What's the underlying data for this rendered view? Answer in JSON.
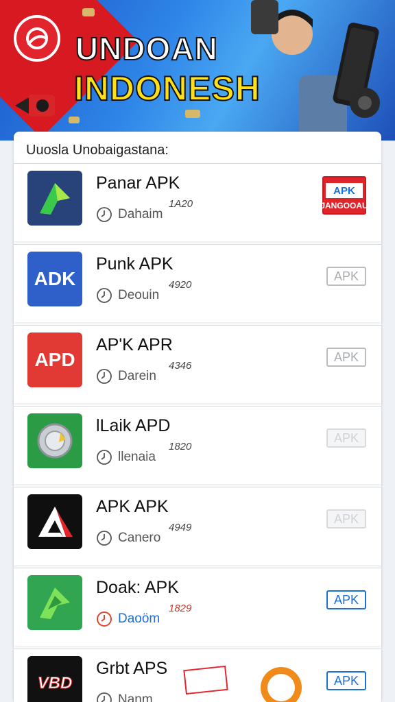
{
  "banner": {
    "title_line1": "UNDOAN",
    "title_line2": "INDONESH",
    "colors": {
      "background": "#2f86e8",
      "title1": "#ffffff",
      "title2": "#ffe01a",
      "logo": "#e2242d"
    }
  },
  "list": {
    "heading": "Uuosla Unobaigastana:",
    "items": [
      {
        "name": "Panar APK",
        "number": "1A20",
        "meta": "Dahaim",
        "button": "APK",
        "button_sub": "JANGOOAU",
        "button_style": "red",
        "icon": "green-arrow-icon",
        "icon_bg": "#27437a"
      },
      {
        "name": "Punk APK",
        "number": "4920",
        "meta": "Deouin",
        "button": "APK",
        "button_style": "grey",
        "icon": "adk-text-icon",
        "icon_text": "ADK",
        "icon_bg": "#2f5fc9"
      },
      {
        "name": "AP'K APR",
        "number": "4346",
        "meta": "Darein",
        "button": "APK",
        "button_style": "grey",
        "icon": "apd-text-icon",
        "icon_text": "APD",
        "icon_bg": "#e13a34"
      },
      {
        "name": "lLaik APD",
        "number": "1820",
        "meta": "llenaia",
        "button": "APK",
        "button_style": "faded",
        "icon": "coin-icon",
        "icon_bg": "#2c9b45"
      },
      {
        "name": "APK APK",
        "number": "4949",
        "meta": "Canero",
        "button": "APK",
        "button_style": "faded",
        "icon": "red-triangle-icon",
        "icon_bg": "#0f0f0f"
      },
      {
        "name": "Doak: APK",
        "number": "1829",
        "meta": "Daoöm",
        "button": "APK",
        "button_style": "blue",
        "icon": "green-arrow-icon",
        "icon_bg": "#31a54f"
      },
      {
        "name": "Grbt APS",
        "number": "",
        "meta": "Nanm",
        "button": "APK",
        "button_style": "blue",
        "icon": "vbd-text-icon",
        "icon_text": "VBD",
        "icon_bg": "#111111"
      }
    ]
  }
}
